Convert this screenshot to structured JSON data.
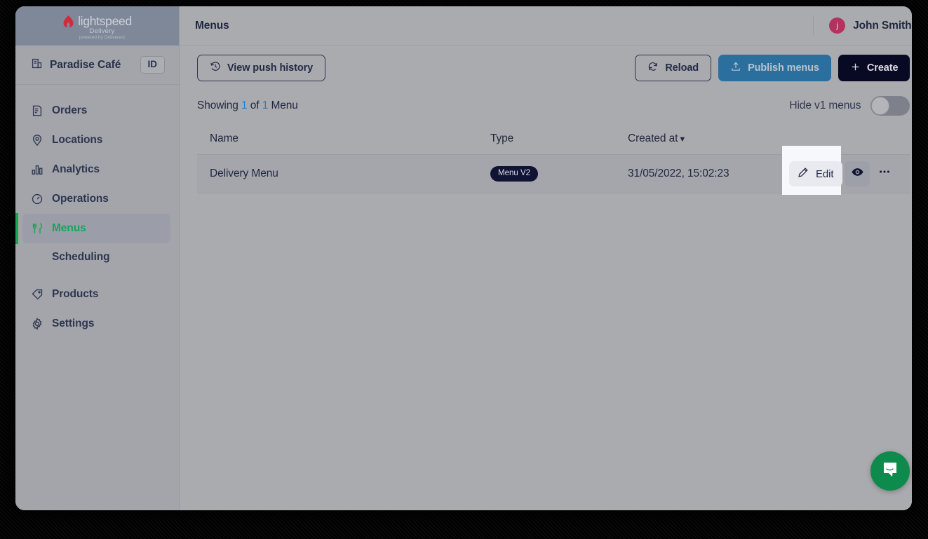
{
  "brand": {
    "name": "lightspeed",
    "product": "Delivery",
    "tagline": "powered by Deliverect",
    "logo_icon": "lightspeed-flame-icon"
  },
  "account": {
    "name": "Paradise Café",
    "icon": "building-icon",
    "id_badge": "ID"
  },
  "sidebar": {
    "items": [
      {
        "label": "Orders",
        "icon": "receipt-icon",
        "active": false
      },
      {
        "label": "Locations",
        "icon": "map-pin-icon",
        "active": false
      },
      {
        "label": "Analytics",
        "icon": "bar-chart-icon",
        "active": false
      },
      {
        "label": "Operations",
        "icon": "gauge-icon",
        "active": false
      },
      {
        "label": "Menus",
        "icon": "cutlery-icon",
        "active": true
      }
    ],
    "subitem": {
      "label": "Scheduling"
    },
    "items_after": [
      {
        "label": "Products",
        "icon": "tag-icon",
        "active": false
      },
      {
        "label": "Settings",
        "icon": "gear-icon",
        "active": false
      }
    ],
    "active_color": "#15a654"
  },
  "header": {
    "title": "Menus",
    "user_name": "John Smith",
    "avatar_initial": "j",
    "avatar_color": "#b4325d"
  },
  "toolbar": {
    "push_history_label": "View push history",
    "push_history_icon": "history-clock-icon",
    "reload_label": "Reload",
    "reload_icon": "refresh-icon",
    "publish_label": "Publish menus",
    "publish_icon": "upload-icon",
    "publish_color": "#2b6f9e",
    "create_label": "Create",
    "create_icon": "plus-icon",
    "create_color": "#080a24"
  },
  "status": {
    "showing_prefix": "Showing",
    "count_shown": "1",
    "of_word": "of",
    "count_total": "1",
    "entity_label": "Menu",
    "number_color": "#2a7fc7"
  },
  "filters": {
    "hide_v1_label": "Hide v1 menus",
    "hide_v1_enabled": false
  },
  "table": {
    "columns": [
      {
        "key": "name",
        "label": "Name"
      },
      {
        "key": "type",
        "label": "Type"
      },
      {
        "key": "created_at",
        "label": "Created at"
      }
    ],
    "sort": {
      "column": "Created at",
      "caret": "▼"
    },
    "rows": [
      {
        "name": "Delivery Menu",
        "type_badge": "Menu V2",
        "created_at": "31/05/2022, 15:02:23",
        "actions": {
          "edit_label": "Edit",
          "edit_icon": "pencil-icon",
          "view_icon": "eye-icon",
          "more_icon": "ellipsis-icon"
        }
      }
    ]
  },
  "chat": {
    "icon": "chat-bubble-icon",
    "color": "#0f8a4d"
  }
}
